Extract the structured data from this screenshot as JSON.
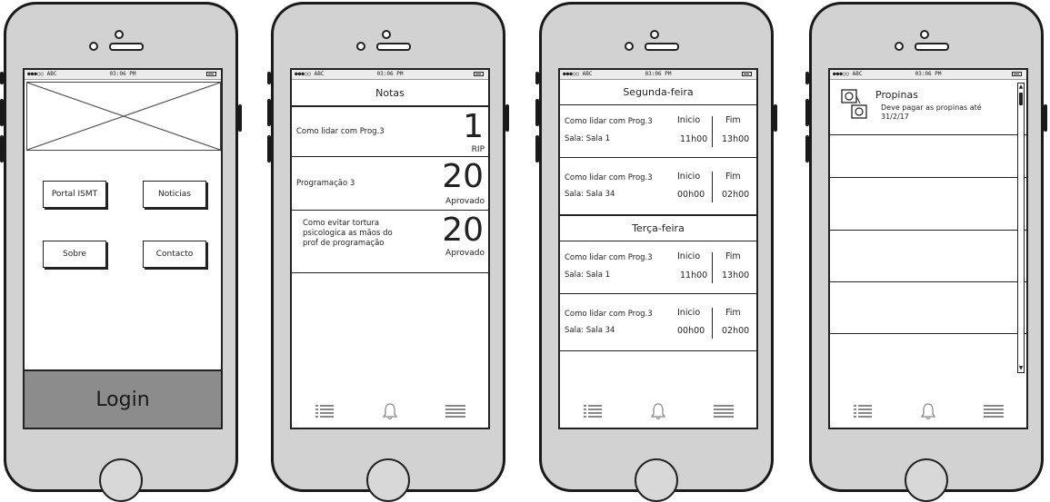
{
  "status_bar": {
    "carrier": "●●●○○ ABC",
    "time": "03:06 PM"
  },
  "screen1": {
    "buttons": [
      "Portal ISMT",
      "Noticias",
      "Sobre",
      "Contacto"
    ],
    "login_label": "Login"
  },
  "screen2": {
    "title": "Notas",
    "grades": [
      {
        "course": "Como lidar com Prog.3",
        "grade": "1",
        "status": "RIP"
      },
      {
        "course": "Programação 3",
        "grade": "20",
        "status": "Aprovado"
      },
      {
        "course": "Como evitar tortura psicologica as mãos do prof de programação",
        "grade": "20",
        "status": "Aprovado"
      }
    ]
  },
  "screen3": {
    "days": [
      {
        "day": "Segunda-feira",
        "classes": [
          {
            "course": "Como lidar com Prog.3",
            "room": "Sala: Sala 1",
            "start_label": "Inicio",
            "start": "11h00",
            "end_label": "Fim",
            "end": "13h00"
          },
          {
            "course": "Como lidar com Prog.3",
            "room": "Sala: Sala 34",
            "start_label": "Inicio",
            "start": "00h00",
            "end_label": "Fim",
            "end": "02h00"
          }
        ]
      },
      {
        "day": "Terça-feira",
        "classes": [
          {
            "course": "Como lidar com Prog.3",
            "room": "Sala: Sala 1",
            "start_label": "Inicio",
            "start": "11h00",
            "end_label": "Fim",
            "end": "13h00"
          },
          {
            "course": "Como lidar com Prog.3",
            "room": "Sala: Sala 34",
            "start_label": "Inicio",
            "start": "00h00",
            "end_label": "Fim",
            "end": "02h00"
          }
        ]
      }
    ]
  },
  "screen4": {
    "notice_title": "Propinas",
    "notice_body": "Deve pagar as propinas até 31/2/17"
  },
  "tab_icons": [
    "list-icon",
    "bell-icon",
    "menu-icon"
  ]
}
